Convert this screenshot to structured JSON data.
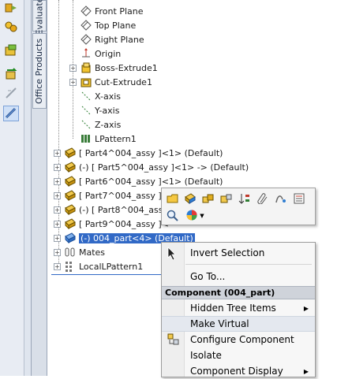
{
  "vertical_tabs": [
    "Evaluate",
    "Office Products"
  ],
  "tree": {
    "features": [
      "Front Plane",
      "Top Plane",
      "Right Plane",
      "Origin",
      "Boss-Extrude1",
      "Cut-Extrude1",
      "X-axis",
      "Y-axis",
      "Z-axis",
      "LPattern1"
    ],
    "components": [
      "[ Part4^004_assy ]<1> (Default)",
      "(-) [ Part5^004_assy ]<1> -> (Default)",
      "[ Part6^004_assy ]<1> (Default)",
      "[ Part7^004_assy ]<",
      "(-) [ Part8^004_assy",
      "[ Part9^004_assy ]<",
      "(-) 004_part<4> (Default)"
    ],
    "mates": "Mates",
    "local_pattern": "LocalLPattern1"
  },
  "context_toolbar": {
    "icons": [
      "open-part-icon",
      "edit-component-icon",
      "assembly-icon",
      "component-properties-icon",
      "reorder-icon",
      "paperclip-icon",
      "rebuild-icon",
      "properties-icon",
      "zoom-to-selection-icon",
      "appearance-icon"
    ]
  },
  "context_menu": {
    "items": [
      {
        "label": "Invert Selection"
      },
      {
        "label": "Go To..."
      }
    ],
    "section_header": "Component (004_part)",
    "component_items": [
      {
        "label": "Hidden Tree Items",
        "submenu": true
      },
      {
        "label": "Make Virtual",
        "submenu": false
      },
      {
        "label": "Configure Component",
        "submenu": false
      },
      {
        "label": "Isolate",
        "submenu": false
      },
      {
        "label": "Component Display",
        "submenu": true
      }
    ]
  },
  "colors": {
    "selection": "#3169c6",
    "toolbar_bg": "#e8ecf3",
    "menu_bg": "#f7f7f7"
  }
}
